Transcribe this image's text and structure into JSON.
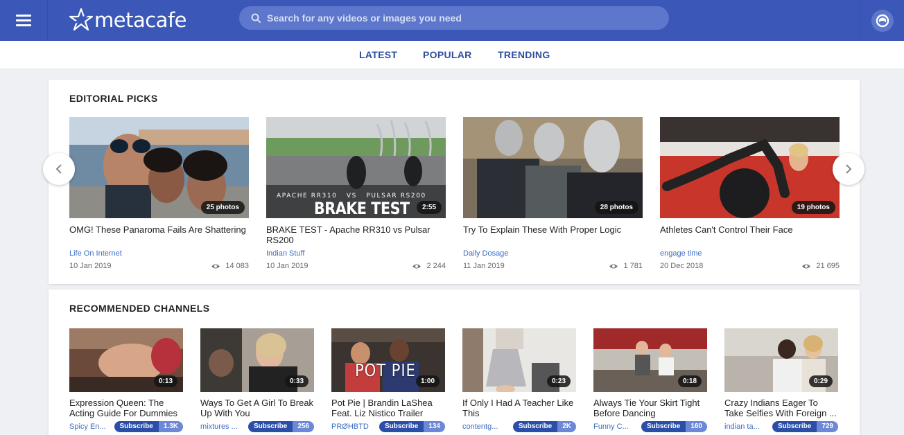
{
  "header": {
    "logo_text": "metacafe",
    "search_placeholder": "Search for any videos or images you need",
    "brand_color": "#3b58b8"
  },
  "nav": {
    "tabs": [
      {
        "label": "LATEST"
      },
      {
        "label": "POPULAR"
      },
      {
        "label": "TRENDING"
      }
    ]
  },
  "editorial": {
    "title": "EDITORIAL PICKS",
    "items": [
      {
        "title": "OMG! These Panaroma Fails Are Shattering",
        "channel": "Life On Internet",
        "date": "10 Jan 2019",
        "views": "14 083",
        "badge": "25 photos"
      },
      {
        "title": "BRAKE TEST - Apache RR310 vs Pulsar RS200",
        "channel": "Indian Stuff",
        "date": "10 Jan 2019",
        "views": "2 244",
        "badge": "2:55",
        "overlay_small": "APACHE RR310   VS   PULSAR RS200",
        "overlay_big": "BRAKE TEST"
      },
      {
        "title": "Try To Explain These With Proper Logic",
        "channel": "Daily Dosage",
        "date": "11 Jan 2019",
        "views": "1 781",
        "badge": "28 photos"
      },
      {
        "title": "Athletes Can't Control Their Face",
        "channel": "engage time",
        "date": "20 Dec 2018",
        "views": "21 695",
        "badge": "19 photos"
      }
    ]
  },
  "recommended": {
    "title": "RECOMMENDED CHANNELS",
    "subscribe_label": "Subscribe",
    "items": [
      {
        "title": "Expression Queen: The Acting Guide For Dummies",
        "channel": "Spicy En...",
        "subs": "1.3K",
        "duration": "0:13"
      },
      {
        "title": "Ways To Get A Girl To Break Up With You",
        "channel": "mixtures ...",
        "subs": "256",
        "duration": "0:33"
      },
      {
        "title": "Pot Pie | Brandin LaShea Feat. Liz Nistico Trailer",
        "channel": "PRØHBTD",
        "subs": "134",
        "duration": "1:00",
        "overlay": "POT PIE"
      },
      {
        "title": "If Only I Had A Teacher Like This",
        "channel": "contentg...",
        "subs": "2K",
        "duration": "0:23"
      },
      {
        "title": "Always Tie Your Skirt Tight Before Dancing",
        "channel": "Funny C...",
        "subs": "160",
        "duration": "0:18"
      },
      {
        "title": "Crazy Indians Eager To Take Selfies With Foreign ...",
        "channel": "indian ta...",
        "subs": "729",
        "duration": "0:29"
      }
    ]
  }
}
